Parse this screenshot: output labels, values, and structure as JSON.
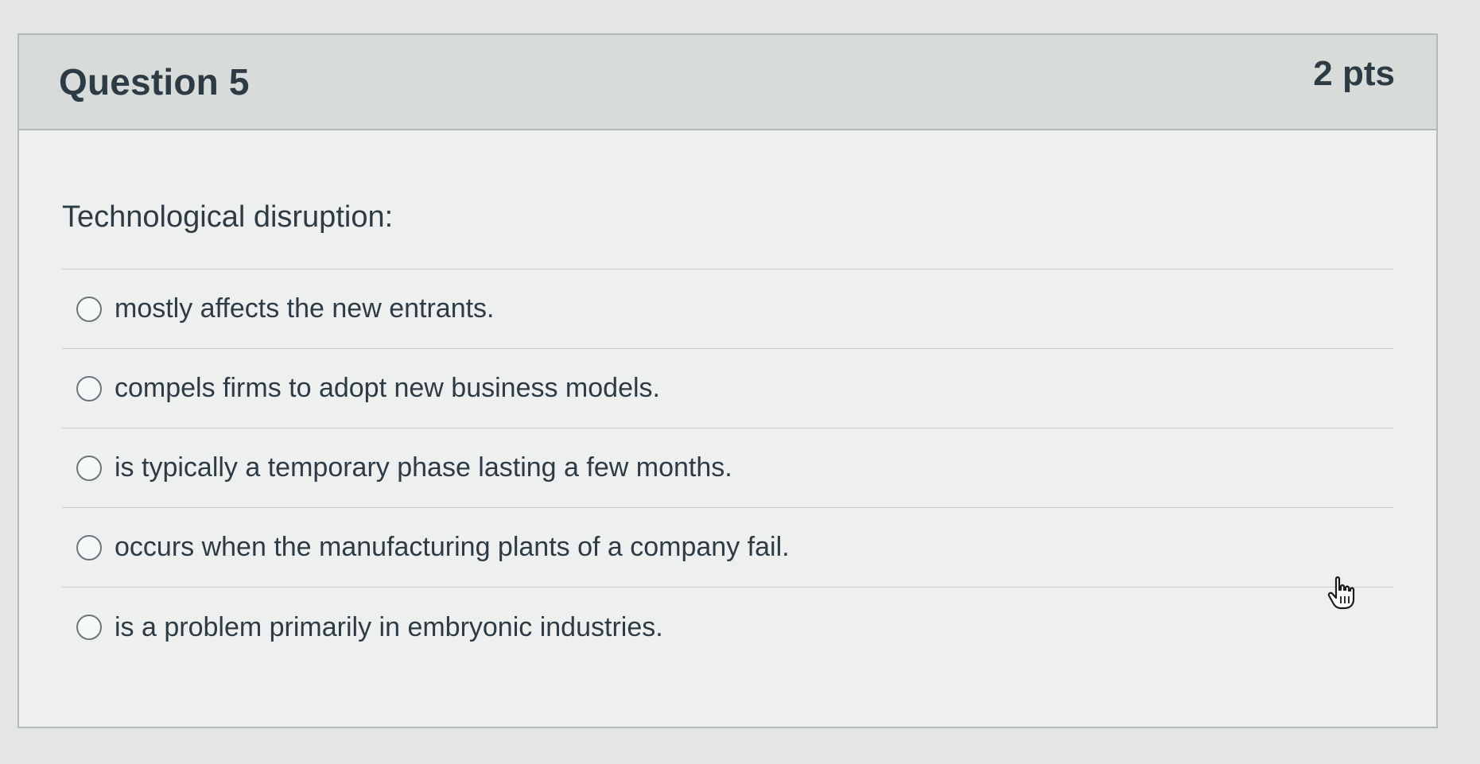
{
  "question": {
    "title": "Question 5",
    "points": "2 pts",
    "prompt": "Technological disruption:"
  },
  "answers": [
    {
      "label": "mostly affects the new entrants."
    },
    {
      "label": "compels firms to adopt new business models."
    },
    {
      "label": "is typically a temporary phase lasting a few months."
    },
    {
      "label": "occurs when the manufacturing plants of a company fail."
    },
    {
      "label": "is a problem primarily in embryonic industries."
    }
  ],
  "icons": {
    "radio": "radio-unselected-icon",
    "cursor": "hand-pointer-cursor-icon"
  },
  "colors": {
    "header_background": "#d7dbd9",
    "card_background": "#eef0ef",
    "text": "#2d3b45",
    "border": "#b4bab8"
  }
}
